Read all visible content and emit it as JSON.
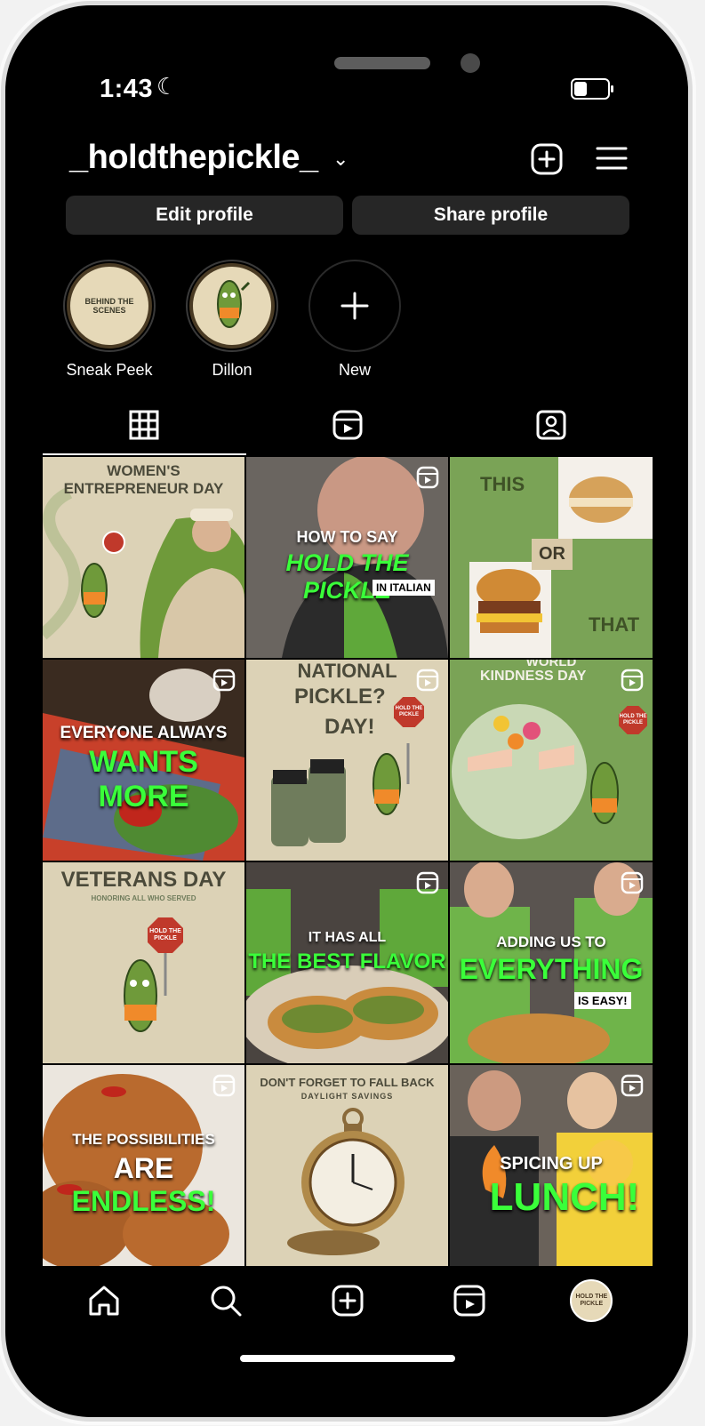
{
  "status": {
    "time": "1:43"
  },
  "profile": {
    "username": "_holdthepickle_",
    "edit_label": "Edit profile",
    "share_label": "Share profile"
  },
  "highlights": [
    {
      "label": "Sneak Peek",
      "inner": "BEHIND THE SCENES"
    },
    {
      "label": "Dillon",
      "inner": ""
    },
    {
      "label": "New",
      "inner": ""
    }
  ],
  "grid": {
    "t1": {
      "title": "WOMEN'S ENTREPRENEUR DAY"
    },
    "t2": {
      "line1": "HOW TO SAY",
      "line2": "HOLD THE PICKLE",
      "line3": "IN ITALIAN"
    },
    "t3": {
      "top": "THIS",
      "mid": "OR",
      "bottom": "THAT"
    },
    "t4": {
      "line1": "EVERYONE ALWAYS",
      "line2": "WANTS MORE"
    },
    "t5": {
      "line1": "NATIONAL",
      "line2": "PICKLE?",
      "line3": "DAY!",
      "sign": "HOLD THE PICKLE"
    },
    "t6": {
      "line1": "WORLD",
      "line2": "KINDNESS DAY",
      "sign": "HOLD THE PICKLE"
    },
    "t7": {
      "line1": "VETERANS DAY",
      "line2": "HONORING ALL WHO SERVED",
      "sign": "HOLD THE PICKLE"
    },
    "t8": {
      "line1": "IT HAS ALL",
      "line2": "THE BEST FLAVOR"
    },
    "t9": {
      "line1": "ADDING US TO",
      "line2": "EVERYTHING",
      "line3": "IS EASY!"
    },
    "t10": {
      "line1": "THE POSSIBILITIES",
      "line2a": "ARE",
      "line2b": "ENDLESS!"
    },
    "t11": {
      "line1": "DON'T FORGET TO FALL BACK",
      "line2": "DAYLIGHT SAVINGS"
    },
    "t12": {
      "line1": "SPICING UP",
      "line2": "LUNCH!"
    }
  },
  "nav": {
    "avatar_text": "HOLD THE PICKLE"
  },
  "colors": {
    "accent_green": "#3aff3a",
    "tile_green": "#7aa356",
    "tile_cream": "#dcd2b6"
  }
}
